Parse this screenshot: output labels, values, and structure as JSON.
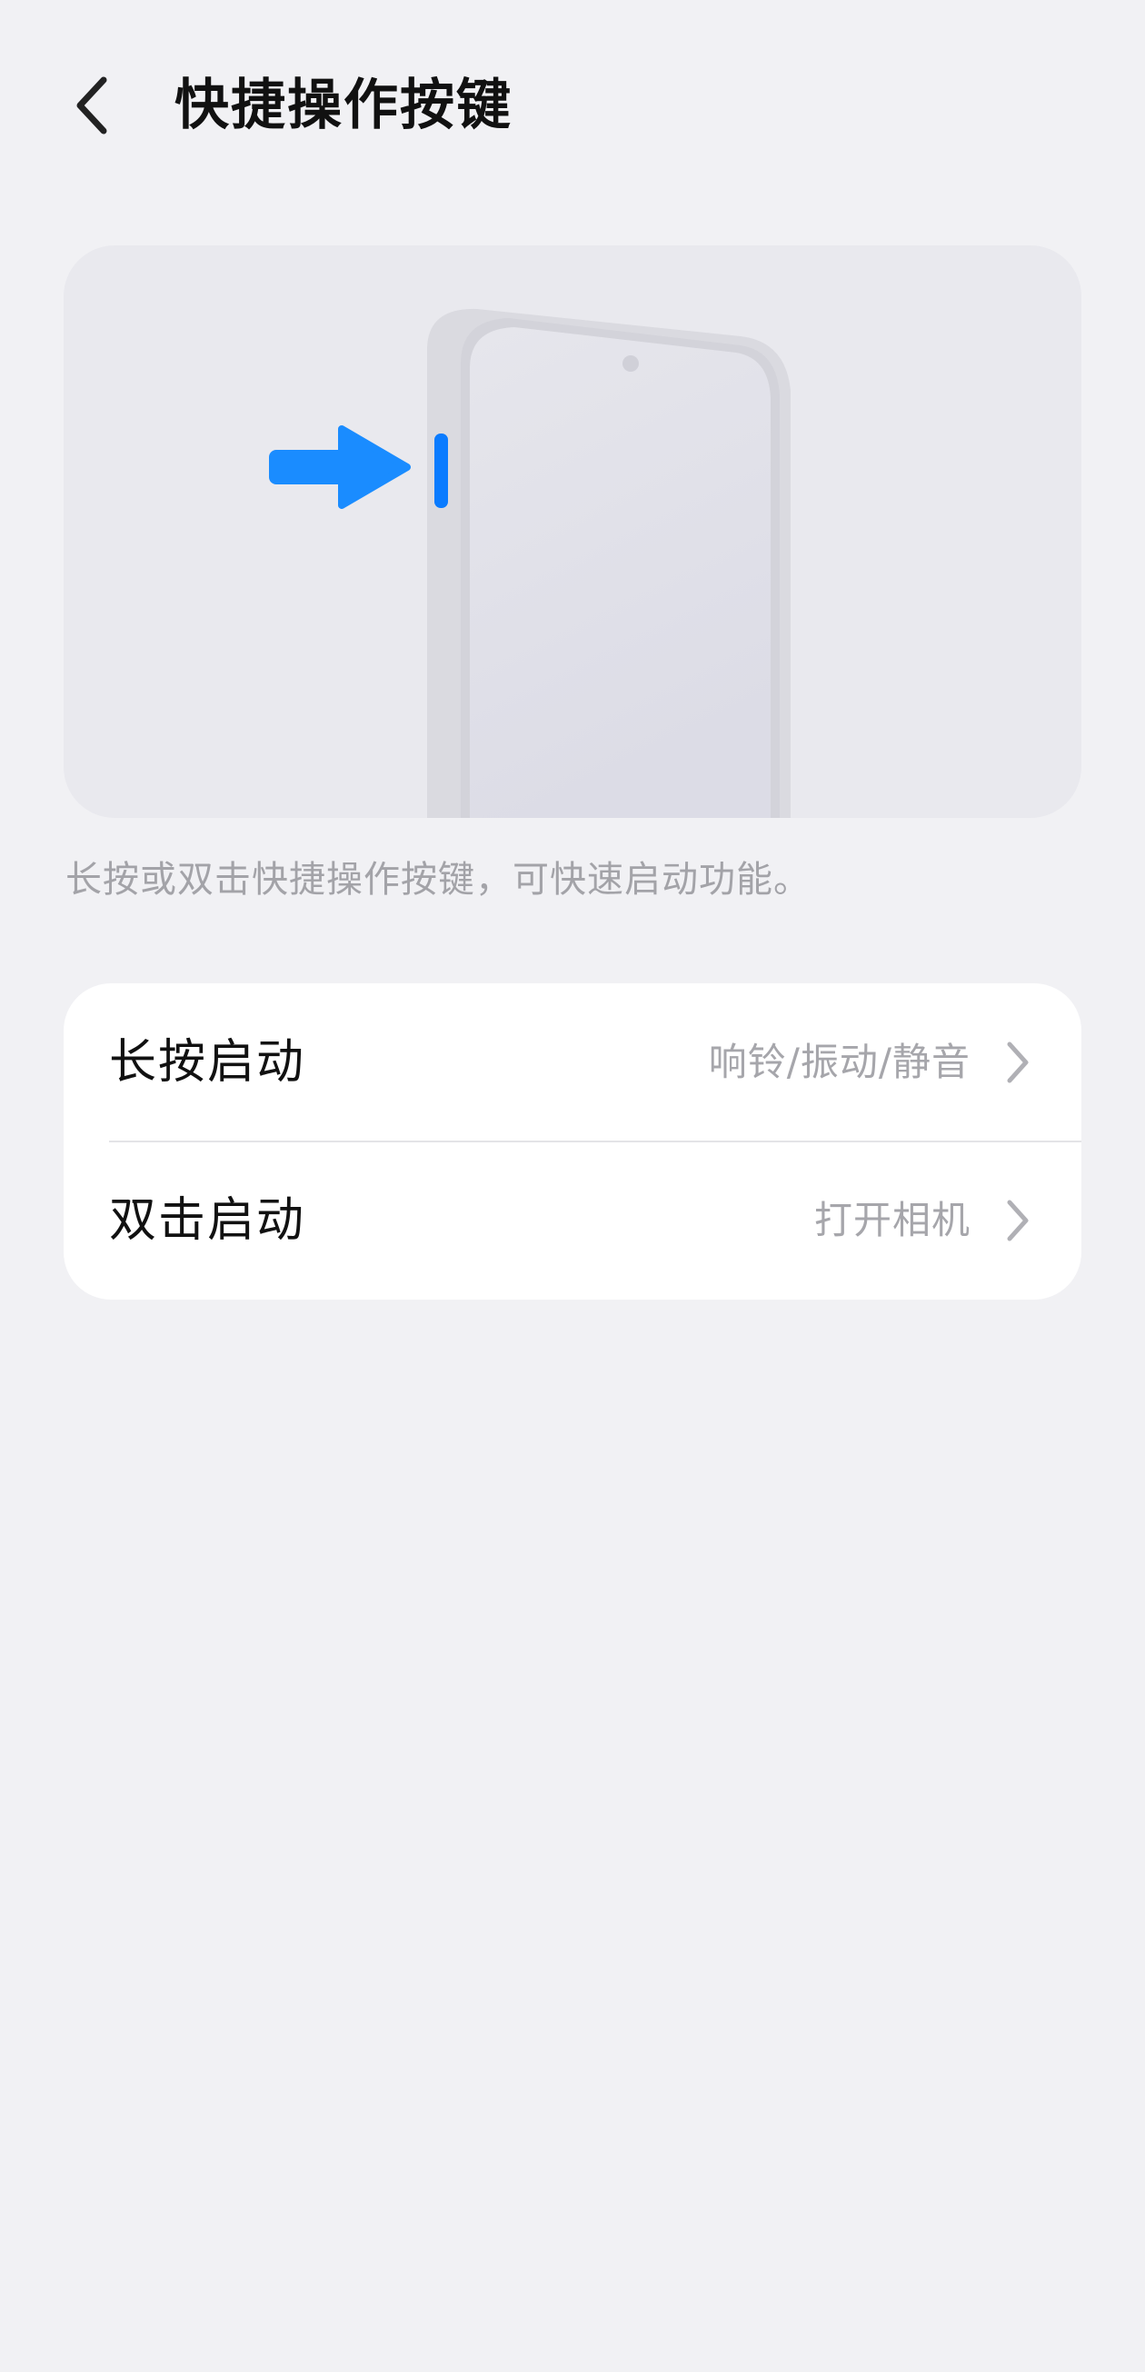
{
  "header": {
    "back_icon": "chevron-left-icon",
    "title": "快捷操作按键"
  },
  "illustration": {
    "arrow_icon": "arrow-right-icon",
    "arrow_color": "#1a8cff",
    "button_highlight_color": "#0a7bff"
  },
  "description": "长按或双击快捷操作按键，可快速启动功能。",
  "settings": {
    "items": [
      {
        "label": "长按启动",
        "value": "响铃/振动/静音",
        "icon": "chevron-right-icon"
      },
      {
        "label": "双击启动",
        "value": "打开相机",
        "icon": "chevron-right-icon"
      }
    ]
  }
}
